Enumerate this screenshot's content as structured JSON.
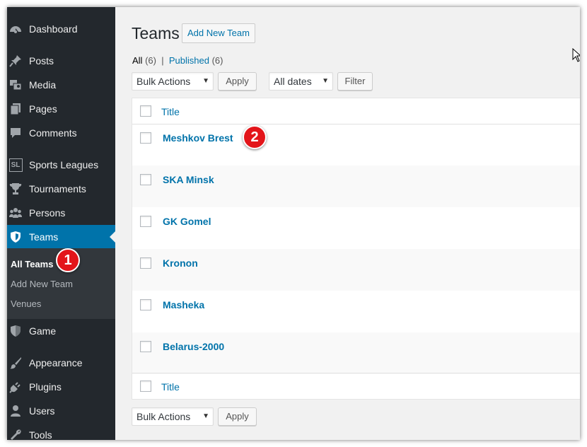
{
  "sidebar": {
    "items": [
      {
        "label": "Dashboard",
        "icon": "dashboard-icon"
      },
      {
        "label": "Posts",
        "icon": "pin-icon"
      },
      {
        "label": "Media",
        "icon": "media-icon"
      },
      {
        "label": "Pages",
        "icon": "pages-icon"
      },
      {
        "label": "Comments",
        "icon": "comments-icon"
      },
      {
        "label": "Sports Leagues",
        "icon": "sl-logo-icon",
        "icon_text": "SL"
      },
      {
        "label": "Tournaments",
        "icon": "trophy-icon"
      },
      {
        "label": "Persons",
        "icon": "groups-icon"
      },
      {
        "label": "Teams",
        "icon": "shield-icon",
        "current": true
      },
      {
        "label": "Game",
        "icon": "shield-half-icon"
      },
      {
        "label": "Appearance",
        "icon": "brush-icon"
      },
      {
        "label": "Plugins",
        "icon": "plug-icon"
      },
      {
        "label": "Users",
        "icon": "user-icon"
      },
      {
        "label": "Tools",
        "icon": "wrench-icon"
      }
    ],
    "submenu": [
      {
        "label": "All Teams",
        "active": true
      },
      {
        "label": "Add New Team"
      },
      {
        "label": "Venues"
      }
    ]
  },
  "main": {
    "title": "Teams",
    "add_new_label": "Add New Team",
    "views": {
      "all_label": "All",
      "all_count": "(6)",
      "separator": "|",
      "published_label": "Published",
      "published_count": "(6)"
    },
    "bulk_actions": "Bulk Actions",
    "apply_label": "Apply",
    "dates_filter": "All dates",
    "filter_label": "Filter",
    "column_title": "Title",
    "teams": [
      "Meshkov Brest",
      "SKA Minsk",
      "GK Gomel",
      "Kronon",
      "Masheka",
      "Belarus-2000"
    ]
  },
  "callouts": [
    "1",
    "2"
  ],
  "colors": {
    "sidebar_bg": "#23282d",
    "submenu_bg": "#32373c",
    "accent": "#0073aa",
    "callout": "#e3151a",
    "page_bg": "#f1f1f1"
  }
}
